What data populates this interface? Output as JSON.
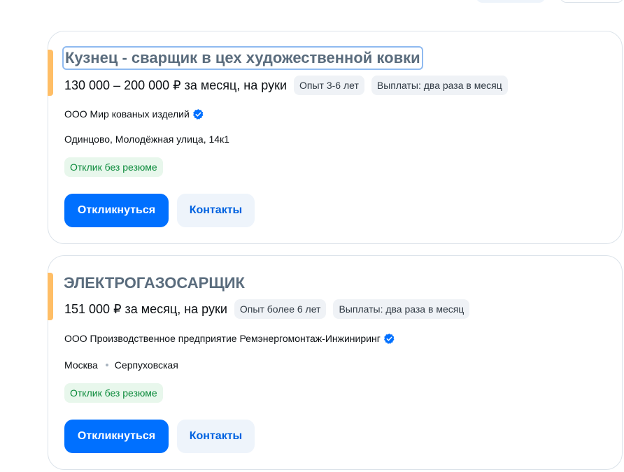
{
  "vacancies": [
    {
      "title": "Кузнец - сварщик в цех художественной ковки",
      "salary": "130 000 – 200 000 ₽ за месяц, на руки",
      "experience": "Опыт 3-6 лет",
      "payouts": "Выплаты: два раза в месяц",
      "company": "ООО Мир кованых изделий",
      "location": "Одинцово, Молодёжная улица, 14к1",
      "metro": "",
      "badge": "Отклик без резюме",
      "respond_label": "Откликнуться",
      "contacts_label": "Контакты"
    },
    {
      "title": "ЭЛЕКТРОГАЗОСАРЩИК",
      "salary": "151 000 ₽ за месяц, на руки",
      "experience": "Опыт более 6 лет",
      "payouts": "Выплаты: два раза в месяц",
      "company": "ООО Производственное предприятие Ремэнергомонтаж-Инжиниринг",
      "location": "Москва",
      "metro": "Серпуховская",
      "badge": "Отклик без резюме",
      "respond_label": "Откликнуться",
      "contacts_label": "Контакты"
    }
  ],
  "icons": {
    "verified": "verified-check-icon"
  },
  "colors": {
    "accent": "#ffbe66",
    "primary": "#0070ff",
    "verified": "#0070ff",
    "badge_text": "#0a8a3a",
    "badge_bg": "#e8f7ec"
  }
}
